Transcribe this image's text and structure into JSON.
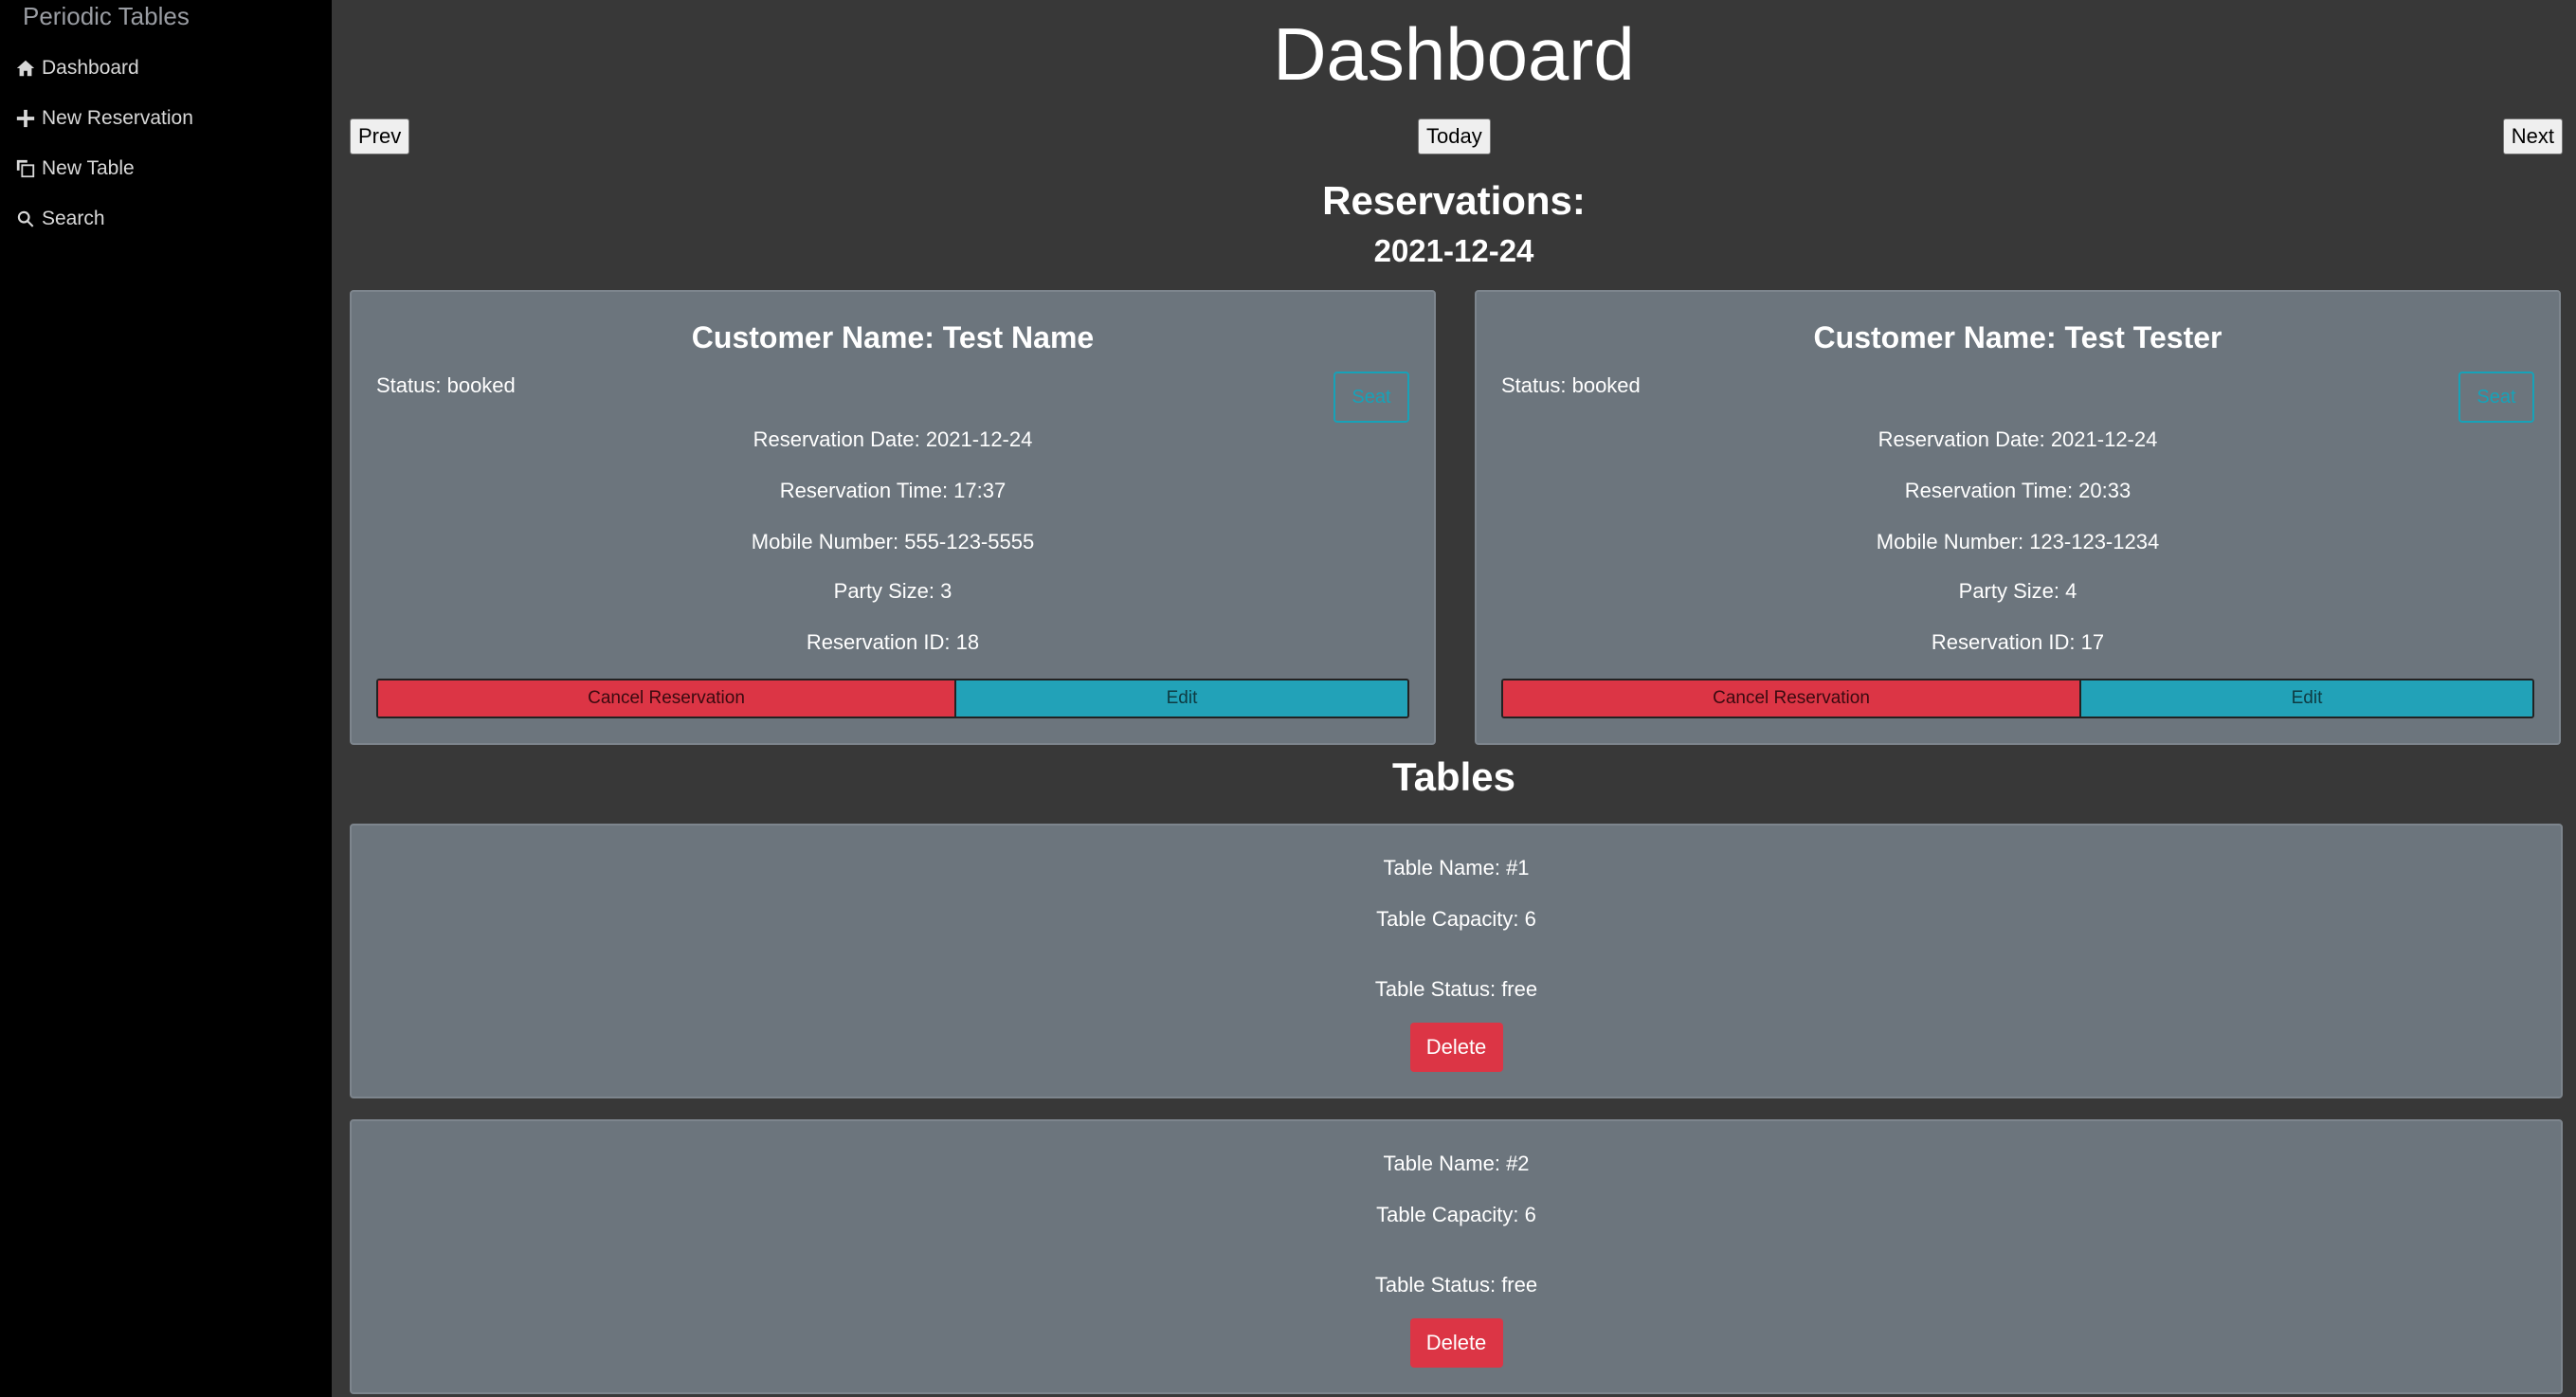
{
  "sidebar": {
    "brand": "Periodic Tables",
    "items": [
      {
        "label": "Dashboard",
        "icon": "home-icon"
      },
      {
        "label": "New Reservation",
        "icon": "plus-icon"
      },
      {
        "label": "New Table",
        "icon": "copy-icon"
      },
      {
        "label": "Search",
        "icon": "search-icon"
      }
    ]
  },
  "header": {
    "title": "Dashboard",
    "prev_label": "Prev",
    "today_label": "Today",
    "next_label": "Next"
  },
  "reservations": {
    "heading": "Reservations:",
    "date": "2021-12-24",
    "cards": [
      {
        "customer": "Customer Name: Test Name",
        "status": "Status: booked",
        "seat_label": "Seat",
        "date": "Reservation Date: 2021-12-24",
        "time": "Reservation Time: 17:37",
        "mobile": "Mobile Number: 555-123-5555",
        "party": "Party Size: 3",
        "id": "Reservation ID: 18",
        "cancel_label": "Cancel Reservation",
        "edit_label": "Edit"
      },
      {
        "customer": "Customer Name: Test Tester",
        "status": "Status: booked",
        "seat_label": "Seat",
        "date": "Reservation Date: 2021-12-24",
        "time": "Reservation Time: 20:33",
        "mobile": "Mobile Number: 123-123-1234",
        "party": "Party Size: 4",
        "id": "Reservation ID: 17",
        "cancel_label": "Cancel Reservation",
        "edit_label": "Edit"
      }
    ]
  },
  "tables": {
    "heading": "Tables",
    "items": [
      {
        "name": "Table Name: #1",
        "capacity": "Table Capacity: 6",
        "status": "Table Status: free",
        "delete_label": "Delete"
      },
      {
        "name": "Table Name: #2",
        "capacity": "Table Capacity: 6",
        "status": "Table Status: free",
        "delete_label": "Delete"
      }
    ]
  },
  "colors": {
    "sidebar_bg": "#000000",
    "page_bg": "#383838",
    "card_bg": "#6c757d",
    "danger": "#dc3545",
    "info": "#17a2b8"
  }
}
